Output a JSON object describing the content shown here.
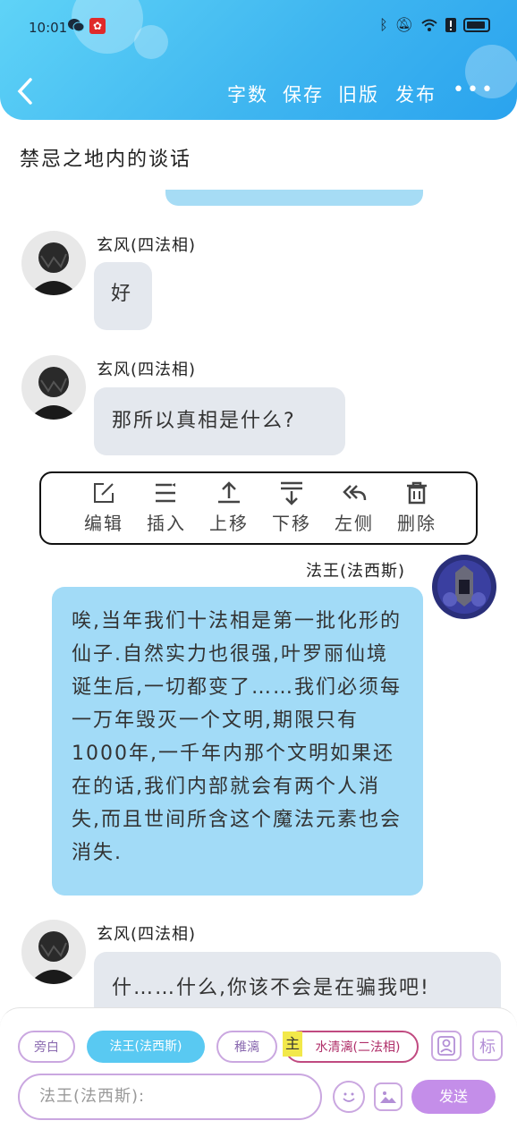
{
  "status_bar": {
    "time": "10:01"
  },
  "header": {
    "buttons": [
      "字数",
      "保存",
      "旧版",
      "发布"
    ],
    "more": "•••"
  },
  "document": {
    "title": "禁忌之地内的谈话"
  },
  "messages": [
    {
      "speaker": "玄风(四法相)",
      "text": "好",
      "side": "left"
    },
    {
      "speaker": "玄风(四法相)",
      "text": "那所以真相是什么?",
      "side": "left"
    },
    {
      "speaker": "法王(法西斯)",
      "text": "唉,当年我们十法相是第一批化形的仙子.自然实力也很强,叶罗丽仙境诞生后,一切都变了……我们必须每一万年毁灭一个文明,期限只有1000年,一千年内那个文明如果还在的话,我们内部就会有两个人消失,而且世间所含这个魔法元素也会消失.",
      "side": "right"
    },
    {
      "speaker": "玄风(四法相)",
      "text": "什……什么,你该不会是在骗我吧!",
      "side": "left"
    }
  ],
  "context_menu": {
    "items": [
      {
        "label": "编辑",
        "icon": "edit-icon"
      },
      {
        "label": "插入",
        "icon": "insert-icon"
      },
      {
        "label": "上移",
        "icon": "move-up-icon"
      },
      {
        "label": "下移",
        "icon": "move-down-icon"
      },
      {
        "label": "左侧",
        "icon": "reply-left-icon"
      },
      {
        "label": "删除",
        "icon": "trash-icon"
      }
    ]
  },
  "composer": {
    "roles": [
      "旁白",
      "法王(法西斯)",
      "稚漓",
      "水清漓(二法相)"
    ],
    "main_marker": "主",
    "placeholder": "法王(法西斯):",
    "send_label": "发送",
    "tag_label": "标"
  },
  "colors": {
    "header": "#3fb6f0",
    "bubble_blue": "#a2dbf7",
    "bubble_gray": "#e4e8ee",
    "accent_purple": "#c48ee9"
  }
}
